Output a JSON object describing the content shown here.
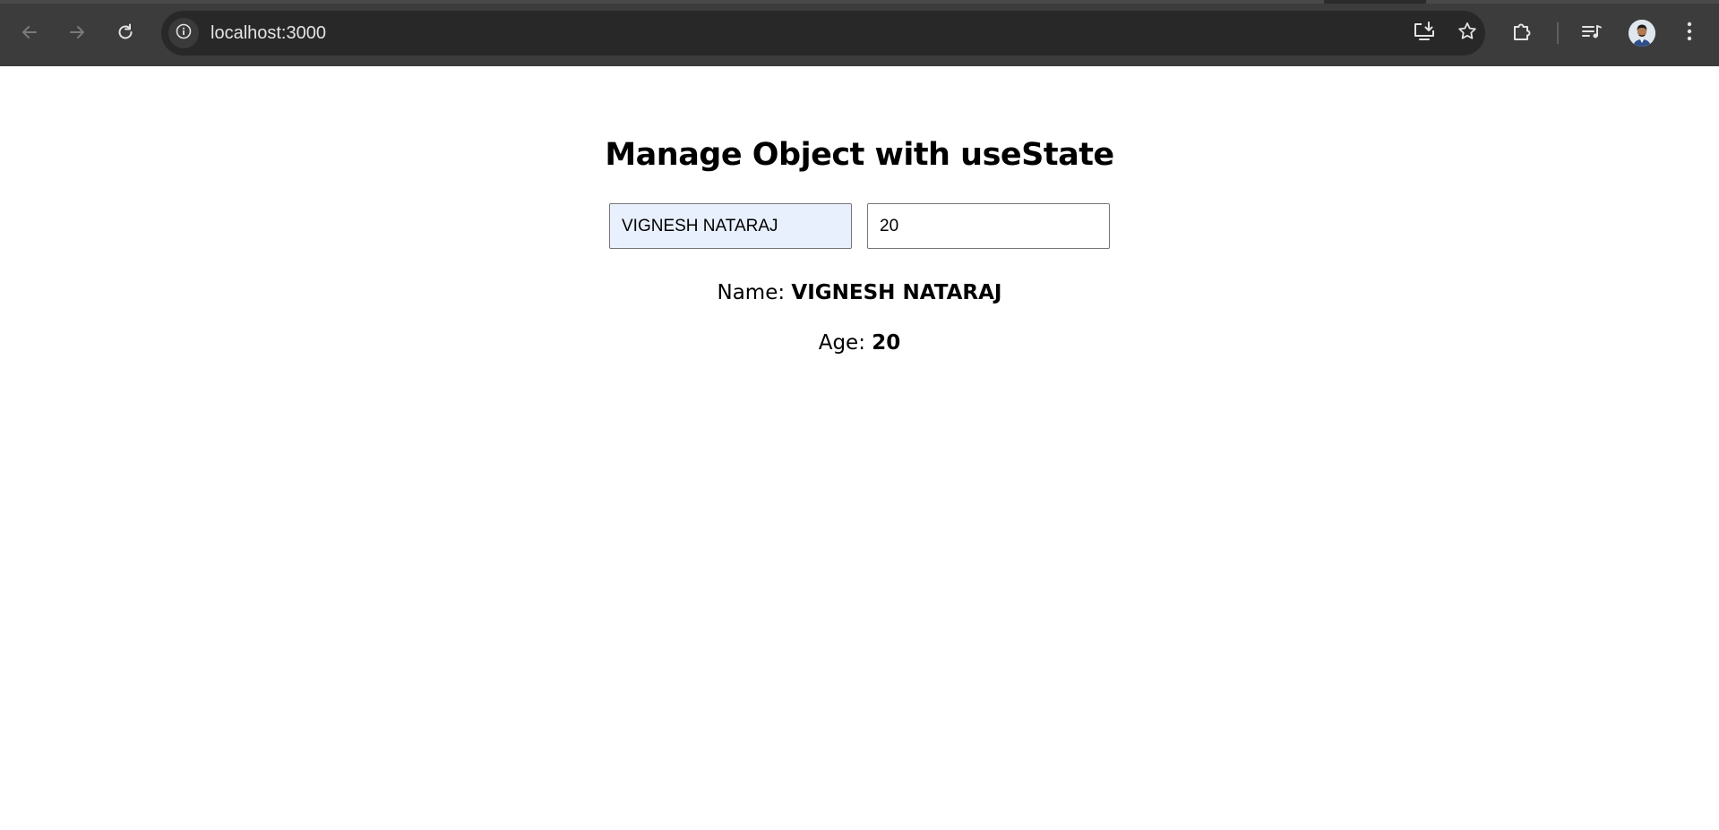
{
  "browser": {
    "url": "localhost:3000",
    "icons": {
      "back": "arrow-left-icon",
      "forward": "arrow-right-icon",
      "reload": "reload-icon",
      "site_info": "info-icon",
      "install": "install-app-icon",
      "bookmark": "star-icon",
      "extensions": "puzzle-icon",
      "media": "media-queue-icon",
      "profile": "avatar",
      "menu": "kebab-menu-icon"
    },
    "colors": {
      "toolbar": "#3c3c3c",
      "omnibox": "#282828",
      "url_text": "#e3e3e3"
    }
  },
  "page": {
    "title": "Manage Object with useState",
    "name_input": {
      "value": "VIGNESH NATARAJ",
      "background": "#e8f0fe"
    },
    "age_input": {
      "value": "20"
    },
    "name_line": {
      "label": "Name:",
      "value": "VIGNESH NATARAJ"
    },
    "age_line": {
      "label": "Age:",
      "value": "20"
    }
  }
}
